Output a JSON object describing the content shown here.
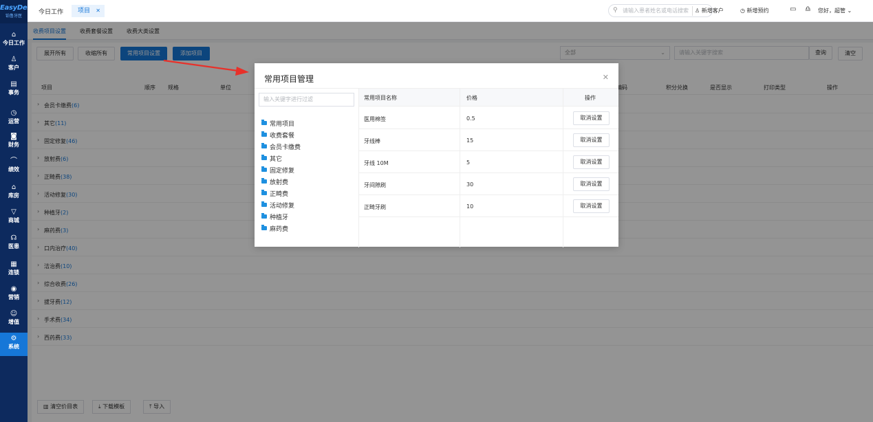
{
  "brand": {
    "name": "EasyDent",
    "sub": "铂鲁牙医"
  },
  "sidebar": {
    "items": [
      {
        "label": "今日工作",
        "icon": "⌂"
      },
      {
        "label": "客户",
        "icon": "♙"
      },
      {
        "label": "事务",
        "icon": "▤"
      },
      {
        "label": "运营",
        "icon": "◷"
      },
      {
        "label": "财务",
        "icon": "◙"
      },
      {
        "label": "绩效",
        "icon": "⌒"
      },
      {
        "label": "库房",
        "icon": "⌂"
      },
      {
        "label": "商城",
        "icon": "▽"
      },
      {
        "label": "医患",
        "icon": "☊"
      },
      {
        "label": "连锁",
        "icon": "▦"
      },
      {
        "label": "营销",
        "icon": "◉"
      },
      {
        "label": "增值",
        "icon": "☺"
      },
      {
        "label": "系统",
        "icon": "⚙"
      }
    ]
  },
  "topbar": {
    "tab_home": "今日工作",
    "tab_active": "项目",
    "search_placeholder": "请输入患者姓名或电话搜索",
    "new_customer": "新增客户",
    "new_appointment": "新增预约",
    "greeting": "您好，超管"
  },
  "subtabs": [
    "收费项目设置",
    "收费套餐设置",
    "收费大类设置"
  ],
  "toolbar": {
    "expand_all": "展开所有",
    "collapse_all": "收缩所有",
    "common_settings": "常用项目设置",
    "add_item": "添加项目",
    "select_value": "全部",
    "keyword_placeholder": "请输入关键字搜索",
    "query": "查询",
    "clear": "清空"
  },
  "table": {
    "headers": {
      "item": "项目",
      "order": "顺序",
      "spec": "规格",
      "unit": "单位",
      "code": "编码",
      "points": "积分兑换",
      "visible": "是否显示",
      "print": "打印类型",
      "ops": "操作"
    },
    "groups": [
      {
        "name": "会员卡缴费",
        "count": "(6)"
      },
      {
        "name": "其它",
        "count": "(11)"
      },
      {
        "name": "固定修复",
        "count": "(46)"
      },
      {
        "name": "放射费",
        "count": "(6)"
      },
      {
        "name": "正畸费",
        "count": "(38)"
      },
      {
        "name": "活动修复",
        "count": "(30)"
      },
      {
        "name": "种植牙",
        "count": "(2)"
      },
      {
        "name": "麻药费",
        "count": "(3)"
      },
      {
        "name": "口内治疗",
        "count": "(40)"
      },
      {
        "name": "洁治费",
        "count": "(10)"
      },
      {
        "name": "综合收费",
        "count": "(26)"
      },
      {
        "name": "拔牙费",
        "count": "(12)"
      },
      {
        "name": "手术费",
        "count": "(34)"
      },
      {
        "name": "西药费",
        "count": "(33)"
      }
    ]
  },
  "bottom": {
    "clear_price": "清空价目表",
    "download": "下载模板",
    "import": "导入"
  },
  "modal": {
    "title": "常用项目管理",
    "filter_placeholder": "输入关键字进行过滤",
    "tree": [
      "常用项目",
      "收费套餐",
      "会员卡缴费",
      "其它",
      "固定修复",
      "放射费",
      "正畸费",
      "活动修复",
      "种植牙",
      "麻药费"
    ],
    "headers": {
      "name": "常用项目名称",
      "price": "价格",
      "ops": "操作"
    },
    "rows": [
      {
        "name": "医用棉签",
        "price": "0.5",
        "action": "取消设置"
      },
      {
        "name": "牙线棒",
        "price": "15",
        "action": "取消设置"
      },
      {
        "name": "牙线 10M",
        "price": "5",
        "action": "取消设置"
      },
      {
        "name": "牙间隙刷",
        "price": "30",
        "action": "取消设置"
      },
      {
        "name": "正畸牙刷",
        "price": "10",
        "action": "取消设置"
      }
    ]
  },
  "colors": {
    "accent": "#1677d8",
    "sidebar": "#0d2a5e",
    "arrow": "#e8312a"
  }
}
